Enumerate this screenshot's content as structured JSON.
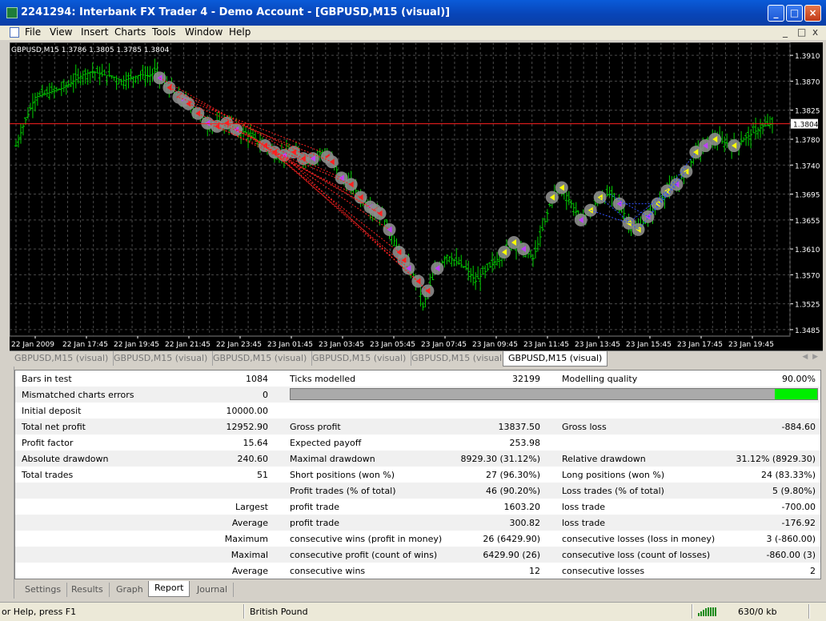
{
  "window": {
    "title": "2241294: Interbank FX Trader 4 - Demo Account - [GBPUSD,M15 (visual)]"
  },
  "menu": {
    "items": [
      "File",
      "View",
      "Insert",
      "Charts",
      "Tools",
      "Window",
      "Help"
    ],
    "mdi_controls": [
      "_",
      "□",
      "x"
    ]
  },
  "chart": {
    "header": "GBPUSD,M15  1.3786 1.3805 1.3785 1.3804",
    "current_price": "1.3804",
    "colors": {
      "background": "#000000",
      "grid": "#4a4a4a",
      "bull": "#00d000",
      "bear": "#00d000",
      "price_line": "#ff2020",
      "axis_text": "#ffffff"
    }
  },
  "chart_data": {
    "type": "candlestick",
    "symbol": "GBPUSD",
    "timeframe": "M15",
    "y_ticks": [
      "1.3910",
      "1.3870",
      "1.3825",
      "1.3780",
      "1.3740",
      "1.3695",
      "1.3655",
      "1.3610",
      "1.3570",
      "1.3525",
      "1.3485"
    ],
    "x_ticks": [
      "22 Jan 2009",
      "22 Jan 17:45",
      "22 Jan 19:45",
      "22 Jan 21:45",
      "22 Jan 23:45",
      "23 Jan 01:45",
      "23 Jan 03:45",
      "23 Jan 05:45",
      "23 Jan 07:45",
      "23 Jan 09:45",
      "23 Jan 11:45",
      "23 Jan 13:45",
      "23 Jan 15:45",
      "23 Jan 17:45",
      "23 Jan 19:45"
    ],
    "ylim": [
      1.3475,
      1.393
    ],
    "current_price": 1.3804,
    "close_path": [
      [
        0,
        1.377
      ],
      [
        2,
        1.381
      ],
      [
        4,
        1.3845
      ],
      [
        6,
        1.385
      ],
      [
        8,
        1.3855
      ],
      [
        10,
        1.386
      ],
      [
        12,
        1.387
      ],
      [
        14,
        1.388
      ],
      [
        16,
        1.3885
      ],
      [
        18,
        1.388
      ],
      [
        20,
        1.3878
      ],
      [
        22,
        1.387
      ],
      [
        24,
        1.3875
      ],
      [
        26,
        1.388
      ],
      [
        28,
        1.3878
      ],
      [
        29,
        1.3885
      ],
      [
        30,
        1.3875
      ],
      [
        32,
        1.386
      ],
      [
        34,
        1.3845
      ],
      [
        36,
        1.3835
      ],
      [
        38,
        1.382
      ],
      [
        40,
        1.3805
      ],
      [
        42,
        1.38
      ],
      [
        44,
        1.3805
      ],
      [
        46,
        1.3795
      ],
      [
        48,
        1.379
      ],
      [
        50,
        1.378
      ],
      [
        52,
        1.377
      ],
      [
        54,
        1.376
      ],
      [
        56,
        1.3755
      ],
      [
        58,
        1.376
      ],
      [
        60,
        1.375
      ],
      [
        62,
        1.375
      ],
      [
        64,
        1.376
      ],
      [
        66,
        1.3745
      ],
      [
        68,
        1.372
      ],
      [
        70,
        1.371
      ],
      [
        72,
        1.369
      ],
      [
        74,
        1.3675
      ],
      [
        76,
        1.3665
      ],
      [
        78,
        1.364
      ],
      [
        80,
        1.3605
      ],
      [
        82,
        1.358
      ],
      [
        84,
        1.356
      ],
      [
        85,
        1.352
      ],
      [
        86,
        1.3545
      ],
      [
        88,
        1.358
      ],
      [
        90,
        1.36
      ],
      [
        92,
        1.359
      ],
      [
        94,
        1.358
      ],
      [
        96,
        1.356
      ],
      [
        98,
        1.3575
      ],
      [
        100,
        1.359
      ],
      [
        102,
        1.3605
      ],
      [
        104,
        1.362
      ],
      [
        106,
        1.361
      ],
      [
        108,
        1.3595
      ],
      [
        110,
        1.364
      ],
      [
        112,
        1.369
      ],
      [
        114,
        1.3705
      ],
      [
        116,
        1.368
      ],
      [
        118,
        1.3655
      ],
      [
        120,
        1.367
      ],
      [
        122,
        1.369
      ],
      [
        124,
        1.3695
      ],
      [
        126,
        1.368
      ],
      [
        128,
        1.365
      ],
      [
        130,
        1.364
      ],
      [
        132,
        1.366
      ],
      [
        134,
        1.368
      ],
      [
        136,
        1.37
      ],
      [
        138,
        1.371
      ],
      [
        140,
        1.373
      ],
      [
        142,
        1.376
      ],
      [
        144,
        1.377
      ],
      [
        146,
        1.378
      ],
      [
        148,
        1.3775
      ],
      [
        150,
        1.377
      ],
      [
        152,
        1.378
      ],
      [
        154,
        1.379
      ],
      [
        156,
        1.38
      ],
      [
        158,
        1.3804
      ]
    ]
  },
  "chart_tabs": [
    "GBPUSD,M15 (visual)",
    "GBPUSD,M15 (visual)",
    "GBPUSD,M15 (visual)",
    "GBPUSD,M15 (visual)",
    "GBPUSD,M15 (visual)",
    "GBPUSD,M15 (visual)"
  ],
  "report": {
    "bars_in_test": {
      "label": "Bars in test",
      "value": "1084"
    },
    "ticks_modelled": {
      "label": "Ticks modelled",
      "value": "32199"
    },
    "modelling_quality": {
      "label": "Modelling quality",
      "value": "90.00%"
    },
    "modelling_quality_fraction": 0.9,
    "mismatched": {
      "label": "Mismatched charts errors",
      "value": "0"
    },
    "initial_deposit": {
      "label": "Initial deposit",
      "value": "10000.00"
    },
    "total_net_profit": {
      "label": "Total net profit",
      "value": "12952.90"
    },
    "gross_profit": {
      "label": "Gross profit",
      "value": "13837.50"
    },
    "gross_loss": {
      "label": "Gross loss",
      "value": "-884.60"
    },
    "profit_factor": {
      "label": "Profit factor",
      "value": "15.64"
    },
    "expected_payoff": {
      "label": "Expected payoff",
      "value": "253.98"
    },
    "absolute_drawdown": {
      "label": "Absolute drawdown",
      "value": "240.60"
    },
    "maximal_drawdown": {
      "label": "Maximal drawdown",
      "value": "8929.30 (31.12%)"
    },
    "relative_drawdown": {
      "label": "Relative drawdown",
      "value": "31.12% (8929.30)"
    },
    "total_trades": {
      "label": "Total trades",
      "value": "51"
    },
    "short_positions": {
      "label": "Short positions (won %)",
      "value": "27 (96.30%)"
    },
    "long_positions": {
      "label": "Long positions (won %)",
      "value": "24 (83.33%)"
    },
    "profit_trades": {
      "label": "Profit trades (% of total)",
      "value": "46 (90.20%)"
    },
    "loss_trades": {
      "label": "Loss trades (% of total)",
      "value": "5 (9.80%)"
    },
    "largest": {
      "label": "Largest",
      "profit_label": "profit trade",
      "profit": "1603.20",
      "loss_label": "loss trade",
      "loss": "-700.00"
    },
    "average": {
      "label": "Average",
      "profit_label": "profit trade",
      "profit": "300.82",
      "loss_label": "loss trade",
      "loss": "-176.92"
    },
    "maximum": {
      "label": "Maximum",
      "wins_label": "consecutive wins (profit in money)",
      "wins": "26 (6429.90)",
      "losses_label": "consecutive losses (loss in money)",
      "losses": "3 (-860.00)"
    },
    "maximal": {
      "label": "Maximal",
      "wins_label": "consecutive profit (count of wins)",
      "wins": "6429.90 (26)",
      "losses_label": "consecutive loss (count of losses)",
      "losses": "-860.00 (3)"
    },
    "average_consec": {
      "label": "Average",
      "wins_label": "consecutive wins",
      "wins": "12",
      "losses_label": "consecutive losses",
      "losses": "2"
    }
  },
  "bottom_tabs": [
    "Settings",
    "Results",
    "Graph",
    "Report",
    "Journal"
  ],
  "status": {
    "help": "or Help, press F1",
    "instrument": "British Pound",
    "traffic": "630/0 kb"
  }
}
